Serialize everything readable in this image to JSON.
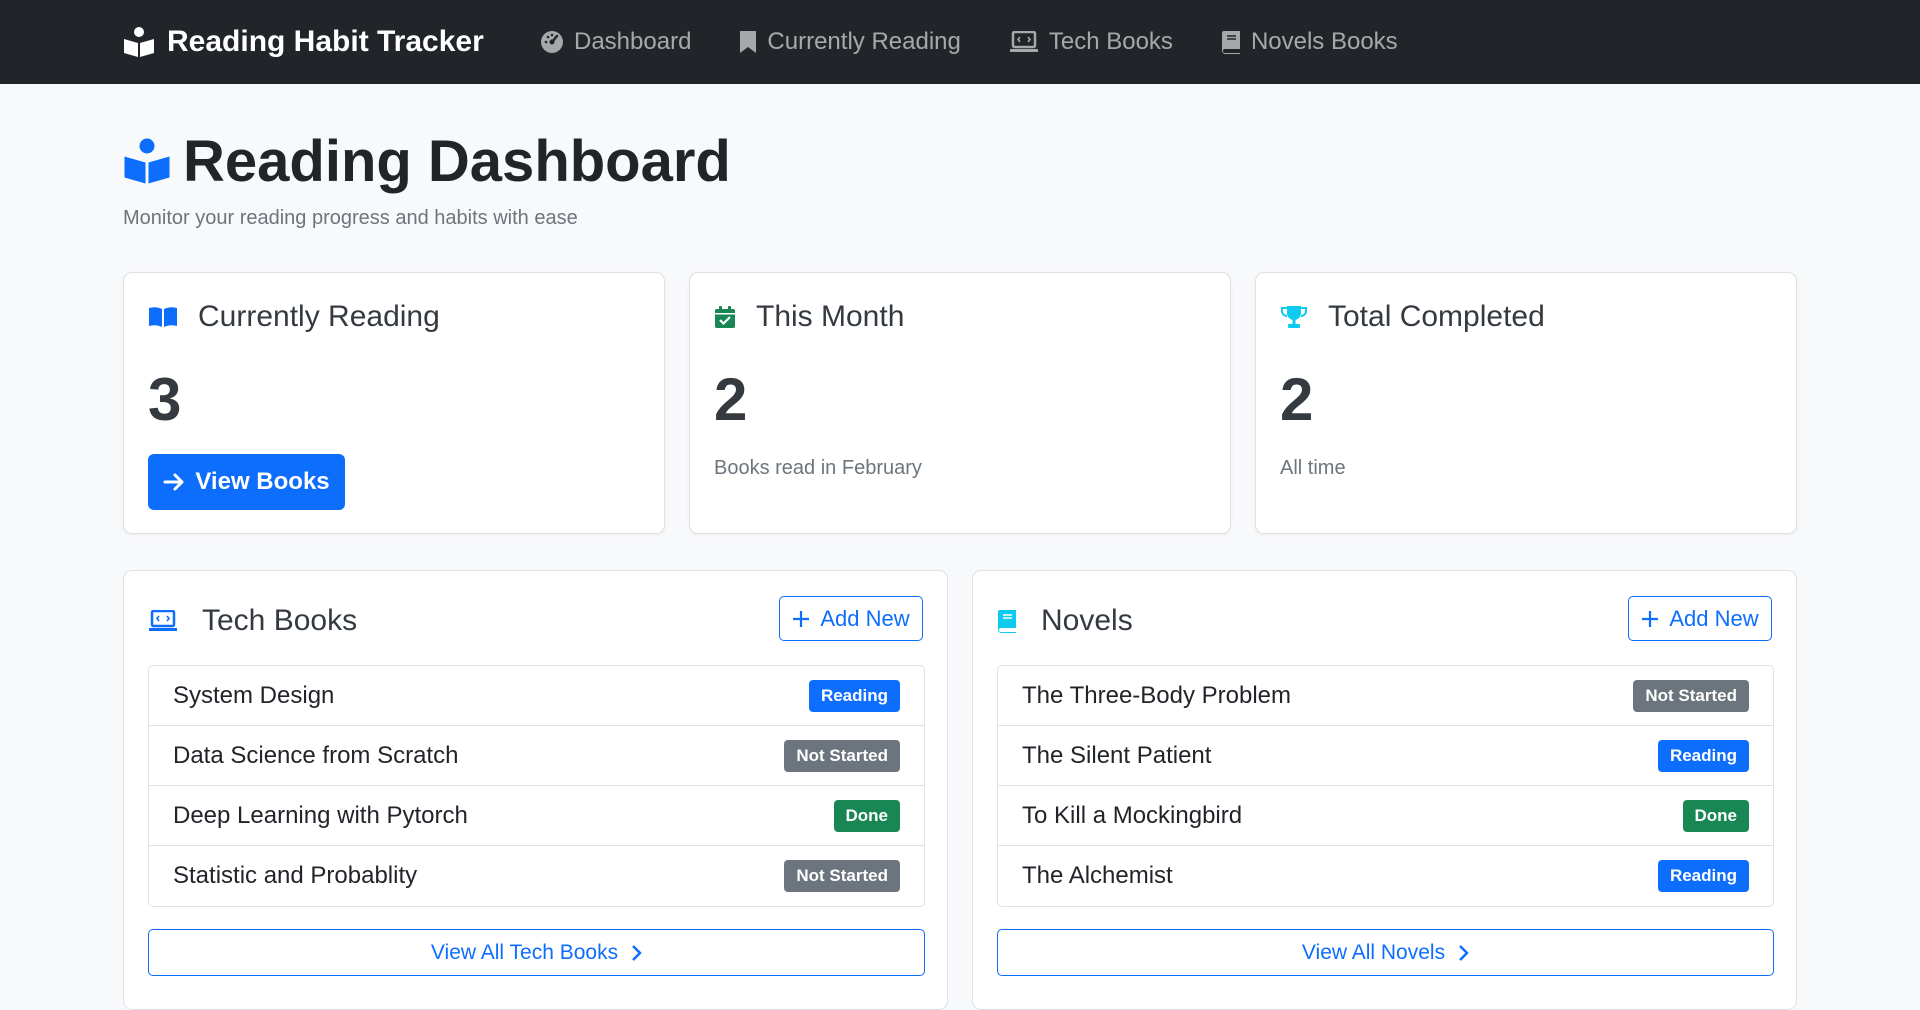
{
  "navbar": {
    "brand": "Reading Habit Tracker",
    "items": [
      {
        "label": "Dashboard",
        "icon": "gauge-icon"
      },
      {
        "label": "Currently Reading",
        "icon": "bookmark-icon"
      },
      {
        "label": "Tech Books",
        "icon": "laptop-code-icon"
      },
      {
        "label": "Novels Books",
        "icon": "book-icon"
      }
    ]
  },
  "header": {
    "title": "Reading Dashboard",
    "subtitle": "Monitor your reading progress and habits with ease"
  },
  "stats": {
    "currently_reading": {
      "title": "Currently Reading",
      "value": "3",
      "button": "View Books"
    },
    "this_month": {
      "title": "This Month",
      "value": "2",
      "caption": "Books read in February"
    },
    "total_completed": {
      "title": "Total Completed",
      "value": "2",
      "caption": "All time"
    }
  },
  "tech": {
    "title": "Tech Books",
    "add_label": "Add New",
    "view_all": "View All Tech Books",
    "books": [
      {
        "title": "System Design",
        "status": "Reading"
      },
      {
        "title": "Data Science from Scratch",
        "status": "Not Started"
      },
      {
        "title": "Deep Learning with Pytorch",
        "status": "Done"
      },
      {
        "title": "Statistic and Probablity",
        "status": "Not Started"
      }
    ]
  },
  "novels": {
    "title": "Novels",
    "add_label": "Add New",
    "view_all": "View All Novels",
    "books": [
      {
        "title": "The Three-Body Problem",
        "status": "Not Started"
      },
      {
        "title": "The Silent Patient",
        "status": "Reading"
      },
      {
        "title": "To Kill a Mockingbird",
        "status": "Done"
      },
      {
        "title": "The Alchemist",
        "status": "Reading"
      }
    ]
  },
  "colors": {
    "navbar_bg": "#212529",
    "primary": "#0d6efd",
    "success": "#198754",
    "secondary": "#6c757d",
    "info": "#0dcaf0"
  }
}
